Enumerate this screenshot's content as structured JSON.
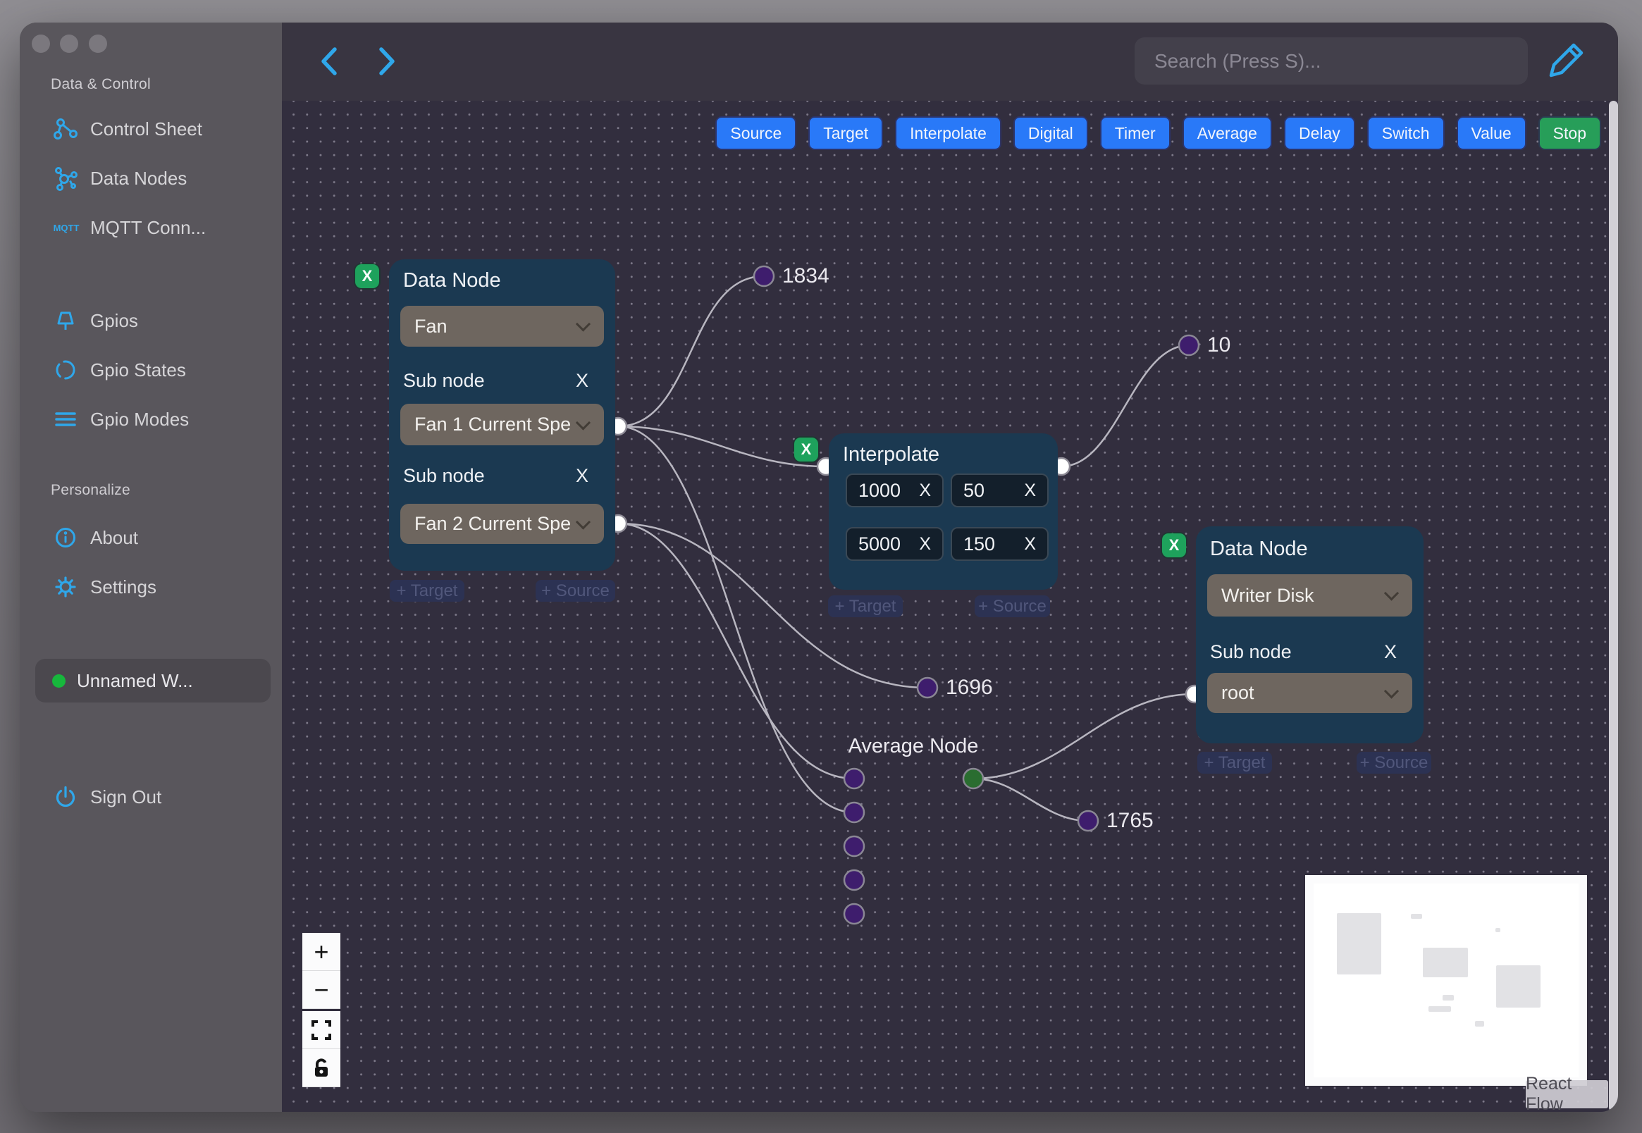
{
  "colors": {
    "accent_blue": "#2fa7ea",
    "toolbar_blue": "#2979f8",
    "toolbar_green": "#279e59",
    "node_bg": "#1b3951",
    "select_bg": "#6e665f",
    "canvas_bg": "#322e3e",
    "sidebar_bg": "#59565c",
    "topbar_bg": "#393541",
    "edge_stroke": "#b8b6c0",
    "port_purple": "#3e1d6d",
    "port_green": "#2a6d30",
    "workflow_status_green": "#17b73c"
  },
  "sidebar": {
    "sections": {
      "data_control": "Data & Control",
      "personalize": "Personalize"
    },
    "mqtt_badge": "MQTT",
    "items": [
      {
        "label": "Control Sheet"
      },
      {
        "label": "Data Nodes"
      },
      {
        "label": "MQTT Conn..."
      },
      {
        "label": "Gpios"
      },
      {
        "label": "Gpio States"
      },
      {
        "label": "Gpio Modes"
      },
      {
        "label": "About"
      },
      {
        "label": "Settings"
      }
    ],
    "workflow": {
      "label": "Unnamed W..."
    },
    "sign_out": "Sign Out"
  },
  "topbar": {
    "search_placeholder": "Search (Press S)..."
  },
  "toolbar": {
    "buttons": [
      {
        "label": "Source"
      },
      {
        "label": "Target"
      },
      {
        "label": "Interpolate"
      },
      {
        "label": "Digital"
      },
      {
        "label": "Timer"
      },
      {
        "label": "Average"
      },
      {
        "label": "Delay"
      },
      {
        "label": "Switch"
      },
      {
        "label": "Value"
      },
      {
        "label": "Stop"
      }
    ]
  },
  "flow": {
    "fan_node": {
      "title": "Data Node",
      "device": "Fan",
      "sub_label": "Sub node",
      "sub1_value": "Fan 1 Current Spe",
      "sub2_value": "Fan 2 Current Spe"
    },
    "interpolate_node": {
      "title": "Interpolate",
      "values": [
        "1000",
        "50",
        "5000",
        "150"
      ]
    },
    "writer_node": {
      "title": "Data Node",
      "device": "Writer Disk",
      "sub_label": "Sub node",
      "sub_value": "root"
    },
    "average_node": {
      "title": "Average Node"
    },
    "edge_labels": [
      "1834",
      "10",
      "1696",
      "1765"
    ],
    "pill_target": "+ Target",
    "pill_source": "+ Source",
    "remove": "X",
    "close": "X"
  },
  "controls": {
    "zoom_in": "+",
    "zoom_out": "−"
  },
  "attribution": "React Flow"
}
